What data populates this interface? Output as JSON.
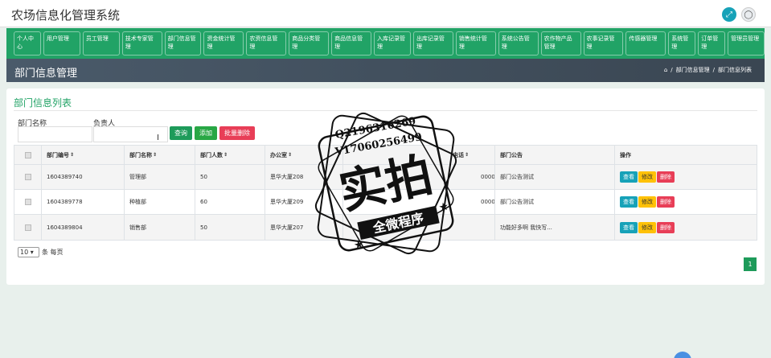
{
  "app": {
    "title": "农场信息化管理系统"
  },
  "topbar": {
    "expand_icon": "expand-icon",
    "user_icon": "user-icon"
  },
  "nav": [
    {
      "label": "个人中心"
    },
    {
      "label": "用户管理"
    },
    {
      "label": "员工管理"
    },
    {
      "label": "技术专家管理"
    },
    {
      "label": "部门信息管理"
    },
    {
      "label": "资金统计管理"
    },
    {
      "label": "农资信息管理"
    },
    {
      "label": "商品分类管理"
    },
    {
      "label": "商品信息管理"
    },
    {
      "label": "入库记录管理"
    },
    {
      "label": "出库记录管理"
    },
    {
      "label": "销售统计管理"
    },
    {
      "label": "系统公告管理"
    },
    {
      "label": "农作物产品管理"
    },
    {
      "label": "农事记录管理"
    },
    {
      "label": "传感器管理"
    },
    {
      "label": "系统管理"
    },
    {
      "label": "订单管理"
    },
    {
      "label": "管理员管理"
    }
  ],
  "page": {
    "heading": "部门信息管理",
    "breadcrumb": [
      "部门信息管理",
      "部门信息列表"
    ],
    "card_title": "部门信息列表"
  },
  "filters": {
    "dept_name_label": "部门名称",
    "owner_label": "负责人",
    "dept_name_value": "",
    "owner_value": ""
  },
  "buttons": {
    "search": "查询",
    "add": "添加",
    "batch_delete": "批量删除"
  },
  "table": {
    "headers": [
      "部门编号",
      "部门名称",
      "部门人数",
      "办公室",
      "电话",
      "部门公告",
      "操作"
    ],
    "rows": [
      {
        "code": "1604389740",
        "name": "管理部",
        "count": "50",
        "office": "恩华大厦208",
        "phone": "00000",
        "notice": "部门公告测试"
      },
      {
        "code": "1604389778",
        "name": "种植部",
        "count": "60",
        "office": "恩华大厦209",
        "phone": "00000",
        "notice": "部门公告测试"
      },
      {
        "code": "1604389804",
        "name": "销售部",
        "count": "50",
        "office": "恩华大厦207",
        "phone": "",
        "notice": "功能好多啊 我快写..."
      }
    ],
    "actions": {
      "view": "查看",
      "edit": "修改",
      "delete": "删除"
    }
  },
  "pager": {
    "page_size": "10",
    "per_page_text": "条 每页",
    "current_page": "1"
  },
  "watermark": {
    "line1": "Q2196316269",
    "line2": "V17060256499",
    "stamp_main": "实拍",
    "stamp_sub": "全微程序"
  }
}
